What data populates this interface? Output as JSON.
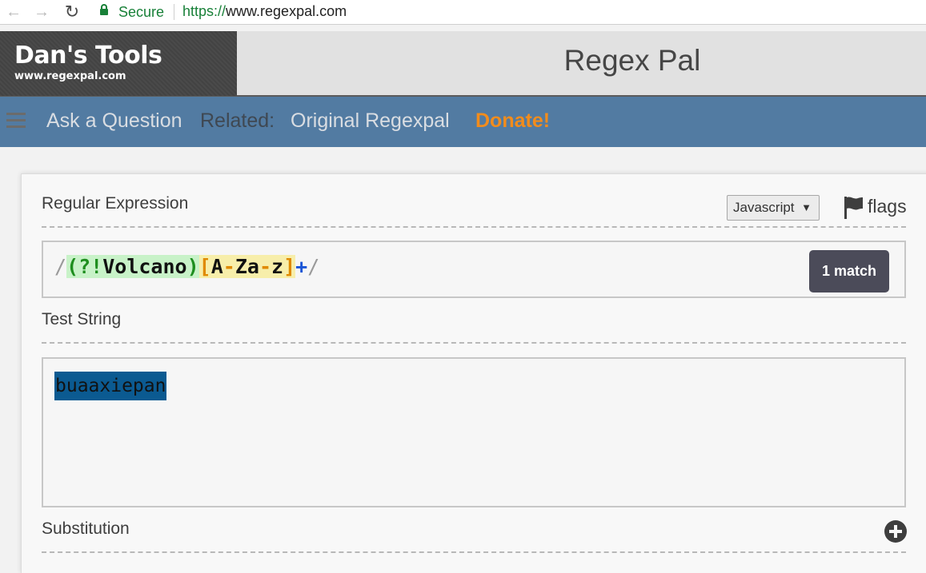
{
  "browser": {
    "secure_label": "Secure",
    "url_scheme": "https://",
    "url_rest": "www.regexpal.com"
  },
  "header": {
    "logo_title": "Dan's Tools",
    "logo_subtitle": "www.regexpal.com",
    "page_title": "Regex Pal"
  },
  "nav": {
    "ask": "Ask a Question",
    "related": "Related:",
    "original": "Original Regexpal",
    "donate": "Donate!"
  },
  "regex_section": {
    "label": "Regular Expression",
    "flavor": "Javascript",
    "flags_label": "flags",
    "delim_open": "/",
    "group_open": "(?!",
    "group_literal": "Volcano",
    "group_close": ")",
    "class_open": "[",
    "class_a": "A",
    "class_dash1": "-",
    "class_za": "Za",
    "class_dash2": "-",
    "class_z": "z",
    "class_close": "]",
    "quantifier": "+",
    "delim_close": "/",
    "match_count": "1 match"
  },
  "test_section": {
    "label": "Test String",
    "value": "buaaxiepan"
  },
  "substitution_section": {
    "label": "Substitution"
  },
  "colors": {
    "nav_background": "#527ba2",
    "donate": "#f28c1c",
    "match_highlight": "#0b5a91",
    "secure_green": "#188038"
  }
}
